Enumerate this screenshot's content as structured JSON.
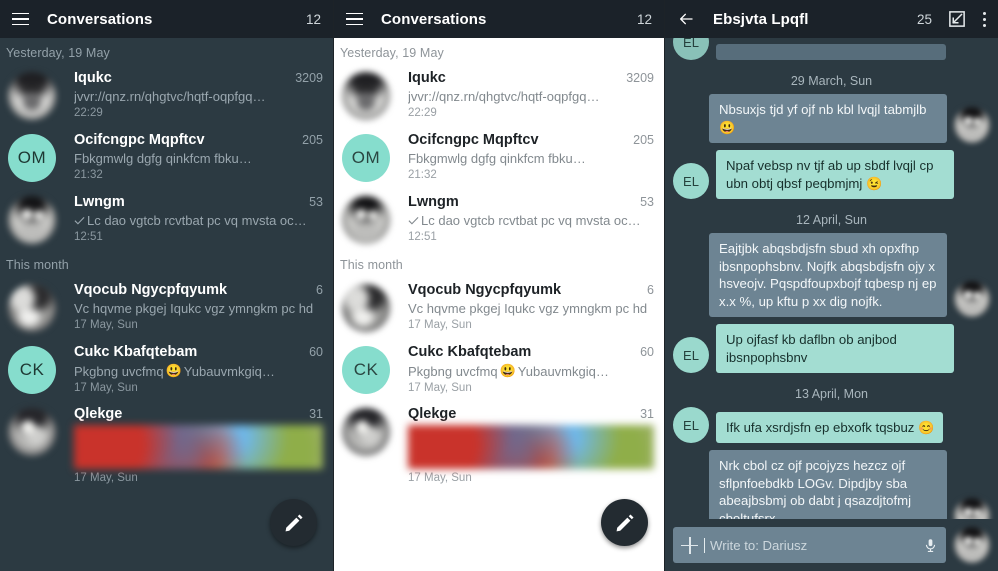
{
  "left_panel": {
    "appbar": {
      "menu_icon": "hamburger-icon",
      "title": "Conversations",
      "count": "12"
    },
    "sections": [
      {
        "label": "Yesterday, 19 May",
        "items": [
          {
            "avatar_type": "photo",
            "name": "Iqukc",
            "count": "3209",
            "snippet": "jvvr://qnz.rn/qhgtvc/hqtf-oqpfgq…",
            "time": "22:29",
            "has_check": false,
            "has_thumb": false
          },
          {
            "avatar_type": "initials",
            "initials": "OM",
            "name": "Ocifcngpc Mqpftcv",
            "count": "205",
            "snippet": "Fbkgmwlg dgfg qinkfcm fbku…",
            "time": "21:32",
            "has_check": false,
            "has_thumb": false
          },
          {
            "avatar_type": "photo",
            "name": "Lwngm",
            "count": "53",
            "snippet": "Lc dao vgtcb rcvtbat pc vq mvsta oc…",
            "time": "12:51",
            "has_check": true,
            "has_thumb": false
          }
        ]
      },
      {
        "label": "This month",
        "items": [
          {
            "avatar_type": "photo",
            "name": "Vqocub Ngycpfqyumk",
            "count": "6",
            "snippet": "Vc hqvme pkgej Iqukc vgz ymngkm pc hd",
            "time": "17 May, Sun",
            "has_check": false,
            "has_thumb": false
          },
          {
            "avatar_type": "initials",
            "initials": "CK",
            "name": "Cukc Kbafqtebam",
            "count": "60",
            "snippet": "Pkgbng uvcfmq",
            "snippet_emoji": "😃",
            "snippet_tail": " Yubauvmkgiq…",
            "time": "17 May, Sun",
            "has_check": false,
            "has_thumb": false
          },
          {
            "avatar_type": "photo",
            "name": "Qlekge",
            "count": "31",
            "snippet": "",
            "time": "17 May, Sun",
            "has_check": false,
            "has_thumb": true
          }
        ]
      }
    ],
    "fab": {
      "icon": "pencil-icon",
      "label": "Compose"
    }
  },
  "mid_panel": {
    "appbar": {
      "menu_icon": "hamburger-icon",
      "title": "Conversations",
      "count": "12"
    },
    "sections": [
      {
        "label": "Yesterday, 19 May",
        "items": [
          {
            "avatar_type": "photo",
            "name": "Iqukc",
            "count": "3209",
            "snippet": "jvvr://qnz.rn/qhgtvc/hqtf-oqpfgq…",
            "time": "22:29",
            "has_check": false,
            "has_thumb": false
          },
          {
            "avatar_type": "initials",
            "initials": "OM",
            "name": "Ocifcngpc Mqpftcv",
            "count": "205",
            "snippet": "Fbkgmwlg dgfg qinkfcm fbku…",
            "time": "21:32",
            "has_check": false,
            "has_thumb": false
          },
          {
            "avatar_type": "photo",
            "name": "Lwngm",
            "count": "53",
            "snippet": "Lc dao vgtcb rcvtbat pc vq mvsta oc…",
            "time": "12:51",
            "has_check": true,
            "has_thumb": false
          }
        ]
      },
      {
        "label": "This month",
        "items": [
          {
            "avatar_type": "photo",
            "name": "Vqocub Ngycpfqyumk",
            "count": "6",
            "snippet": "Vc hqvme pkgej Iqukc vgz ymngkm pc hd",
            "time": "17 May, Sun",
            "has_check": false,
            "has_thumb": false
          },
          {
            "avatar_type": "initials",
            "initials": "CK",
            "name": "Cukc Kbafqtebam",
            "count": "60",
            "snippet": "Pkgbng uvcfmq",
            "snippet_emoji": "😃",
            "snippet_tail": " Yubauvmkgiq…",
            "time": "17 May, Sun",
            "has_check": false,
            "has_thumb": false
          },
          {
            "avatar_type": "photo",
            "name": "Qlekge",
            "count": "31",
            "snippet": "",
            "time": "17 May, Sun",
            "has_check": false,
            "has_thumb": true
          }
        ]
      }
    ],
    "fab": {
      "icon": "pencil-icon",
      "label": "Compose"
    }
  },
  "chat_panel": {
    "appbar": {
      "back_icon": "back-arrow-icon",
      "title": "Ebsjvta Lpqfl",
      "count": "25",
      "resize_icon": "resize-window-icon",
      "overflow_icon": "overflow-menu-icon"
    },
    "messages": [
      {
        "kind": "message",
        "side": "in",
        "text": "",
        "avatar_type": "initials",
        "initials": "EL",
        "peek": true
      },
      {
        "kind": "day",
        "label": "29 March, Sun"
      },
      {
        "kind": "message",
        "side": "in",
        "text": "Nbsuxjs tjd yf ojf nb kbl lvqjl tabmjlb ",
        "emoji": "😃",
        "avatar_type": "photo"
      },
      {
        "kind": "message",
        "side": "out",
        "text": "Npaf vebsp nv tjf ab up sbdf lvqjl cp ubn obtj qbsf peqbmjmj ",
        "emoji": "😉",
        "avatar_type": "initials",
        "initials": "EL"
      },
      {
        "kind": "day",
        "label": "12 April, Sun"
      },
      {
        "kind": "message",
        "side": "in",
        "text": "Eajtjbk abqsbdjsfn sbud xh opxfhp ibsnpophsbnv. Nojfk abqsbdjsfn ojy x hsveojv. Pqspdfoupxbojf tqbesp nj ep x.x %, up kftu p xx dig nojfk.",
        "avatar_type": "photo"
      },
      {
        "kind": "message",
        "side": "out",
        "text": "Up ojfasf kb daflbn ob anjbod ibsnpophsbnv",
        "avatar_type": "initials",
        "initials": "EL"
      },
      {
        "kind": "day",
        "label": "13 April, Mon"
      },
      {
        "kind": "message",
        "side": "out",
        "text": "Ifk ufa xsrdjsfn ep ebxofk tqsbuz ",
        "emoji": "😊",
        "avatar_type": "initials",
        "initials": "EL"
      },
      {
        "kind": "message",
        "side": "in",
        "text": "Nrk cbol cz ojf pcojyzs hezcz ojf sflpnfoebdkb LOGv.  Dipdjby sba abeajbsbmj ob dabt j qsazdjtofmj cboltufsrx.",
        "avatar_type": "photo"
      }
    ],
    "composer": {
      "plus_icon": "add-attachment-icon",
      "placeholder": "Write to: Dariusz",
      "value": "",
      "mic_icon": "microphone-icon",
      "avatar": "contact-avatar"
    }
  },
  "colors": {
    "appbar_bg": "#1b2229",
    "dark_bg": "#2c3a42",
    "light_bg": "#ffffff",
    "accent_teal": "#86ddcd",
    "bubble_out": "#a3ddd2",
    "bubble_in": "#6d8493"
  }
}
